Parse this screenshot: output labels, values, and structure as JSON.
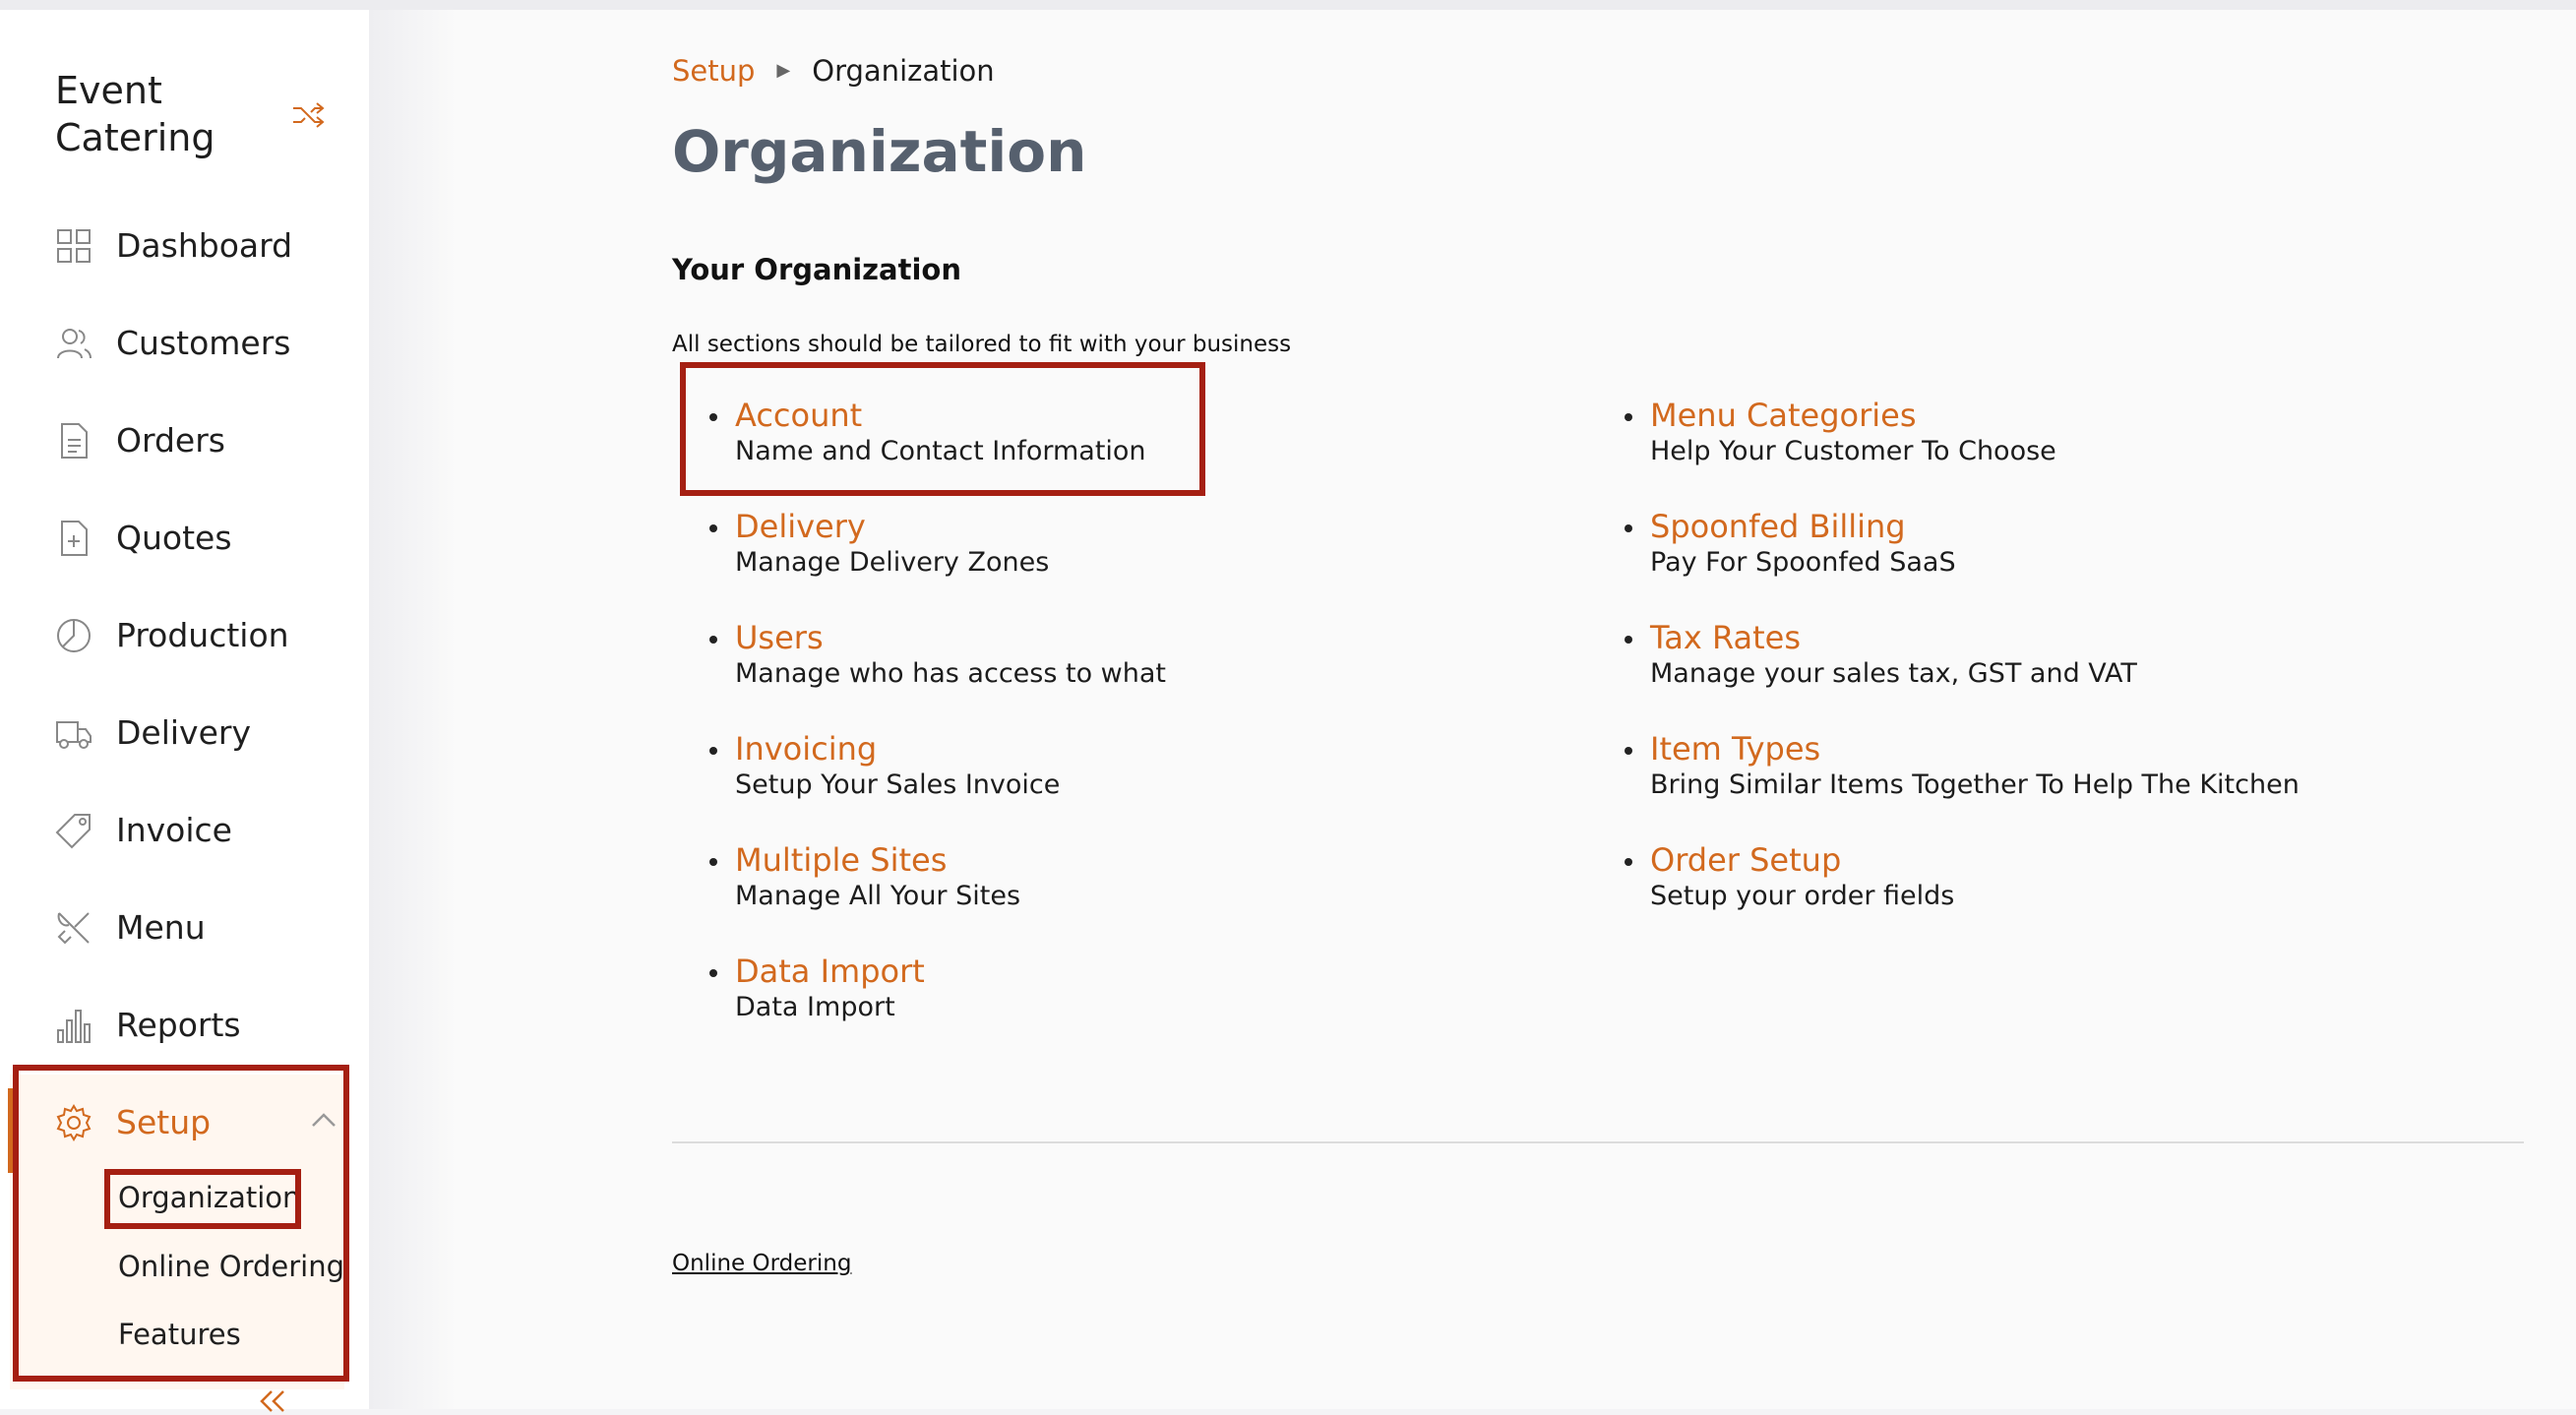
{
  "app": {
    "brand": "Event Catering"
  },
  "sidebar": {
    "items": [
      {
        "label": "Dashboard",
        "icon": "dashboard-icon"
      },
      {
        "label": "Customers",
        "icon": "customers-icon"
      },
      {
        "label": "Orders",
        "icon": "orders-icon"
      },
      {
        "label": "Quotes",
        "icon": "quotes-icon"
      },
      {
        "label": "Production",
        "icon": "production-icon"
      },
      {
        "label": "Delivery",
        "icon": "delivery-truck-icon"
      },
      {
        "label": "Invoice",
        "icon": "invoice-tag-icon"
      },
      {
        "label": "Menu",
        "icon": "utensils-icon"
      },
      {
        "label": "Reports",
        "icon": "bar-chart-icon"
      },
      {
        "label": "Setup",
        "icon": "gear-icon",
        "active": true
      }
    ],
    "setup_subitems": [
      "Organization",
      "Online Ordering",
      "Features"
    ]
  },
  "breadcrumb": {
    "parent": "Setup",
    "current": "Organization"
  },
  "page": {
    "title": "Organization",
    "section_title": "Your Organization",
    "section_desc": "All sections should be tailored to fit with your business"
  },
  "left_entries": [
    {
      "title": "Account",
      "desc": "Name and Contact Information"
    },
    {
      "title": "Delivery",
      "desc": "Manage Delivery Zones"
    },
    {
      "title": "Users",
      "desc": "Manage who has access to what"
    },
    {
      "title": "Invoicing",
      "desc": "Setup Your Sales Invoice"
    },
    {
      "title": "Multiple Sites",
      "desc": "Manage All Your Sites"
    },
    {
      "title": "Data Import",
      "desc": "Data Import"
    }
  ],
  "right_entries": [
    {
      "title": "Menu Categories",
      "desc": "Help Your Customer To Choose"
    },
    {
      "title": "Spoonfed Billing",
      "desc": "Pay For Spoonfed SaaS"
    },
    {
      "title": "Tax Rates",
      "desc": "Manage your sales tax, GST and VAT"
    },
    {
      "title": "Item Types",
      "desc": "Bring Similar Items Together To Help The Kitchen"
    },
    {
      "title": "Order Setup",
      "desc": "Setup your order fields"
    }
  ],
  "footer": {
    "link": "Online Ordering"
  },
  "colors": {
    "accent": "#d2691e",
    "title_gray": "#56606e",
    "highlight": "#a51f12"
  }
}
